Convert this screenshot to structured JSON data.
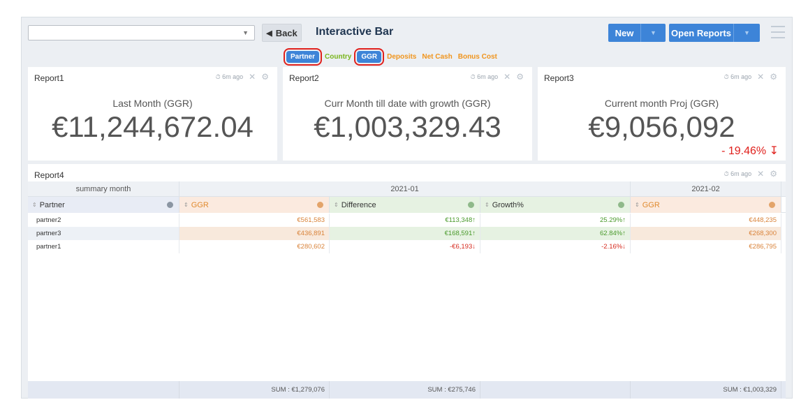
{
  "toolbar": {
    "select_value": "",
    "back_label": "Back",
    "title": "Interactive Bar",
    "new_label": "New",
    "open_reports_label": "Open Reports"
  },
  "tags": [
    {
      "label": "Partner",
      "selected": true,
      "color": "#3d84d8"
    },
    {
      "label": "Country",
      "selected": false,
      "color": "#79b51c"
    },
    {
      "label": "GGR",
      "selected": true,
      "color": "#3d84d8"
    },
    {
      "label": "Deposits",
      "selected": false,
      "color": "#f0941c"
    },
    {
      "label": "Net Cash",
      "selected": false,
      "color": "#f0941c"
    },
    {
      "label": "Bonus Cost",
      "selected": false,
      "color": "#f0941c"
    }
  ],
  "cards": [
    {
      "title": "Report1",
      "time": "6m ago",
      "label": "Last Month (GGR)",
      "value": "€11,244,672.04"
    },
    {
      "title": "Report2",
      "time": "6m ago",
      "label": "Curr Month till date with growth (GGR)",
      "value": "€1,003,329.43"
    },
    {
      "title": "Report3",
      "time": "6m ago",
      "label": "Current month Proj (GGR)",
      "value": "€9,056,092",
      "change": "- 19.46%"
    }
  ],
  "table": {
    "title": "Report4",
    "time": "6m ago",
    "group_header": "summary month",
    "month1": "2021-01",
    "month2": "2021-02",
    "col_partner": "Partner",
    "col_ggr": "GGR",
    "col_diff": "Difference",
    "col_growth": "Growth%",
    "col_ggr2": "GGR",
    "rows": [
      {
        "partner": "partner2",
        "ggr": "€561,583",
        "diff": "€113,348",
        "growth": "25.29%",
        "ggr2": "€448,235",
        "dir": "up"
      },
      {
        "partner": "partner3",
        "ggr": "€436,891",
        "diff": "€168,591",
        "growth": "62.84%",
        "ggr2": "€268,300",
        "dir": "up"
      },
      {
        "partner": "partner1",
        "ggr": "€280,602",
        "diff": "-€6,193",
        "growth": "-2.16%",
        "ggr2": "€286,795",
        "dir": "down"
      }
    ],
    "sums": {
      "ggr": "SUM : €1,279,076",
      "diff": "SUM : €275,746",
      "ggr2": "SUM : €1,003,329"
    }
  },
  "colors": {
    "accent": "#3d84d8",
    "positive": "#4a9a2c",
    "negative": "#d62a1e",
    "ggr": "#d9833a",
    "highlight_box": "#e0201c"
  }
}
